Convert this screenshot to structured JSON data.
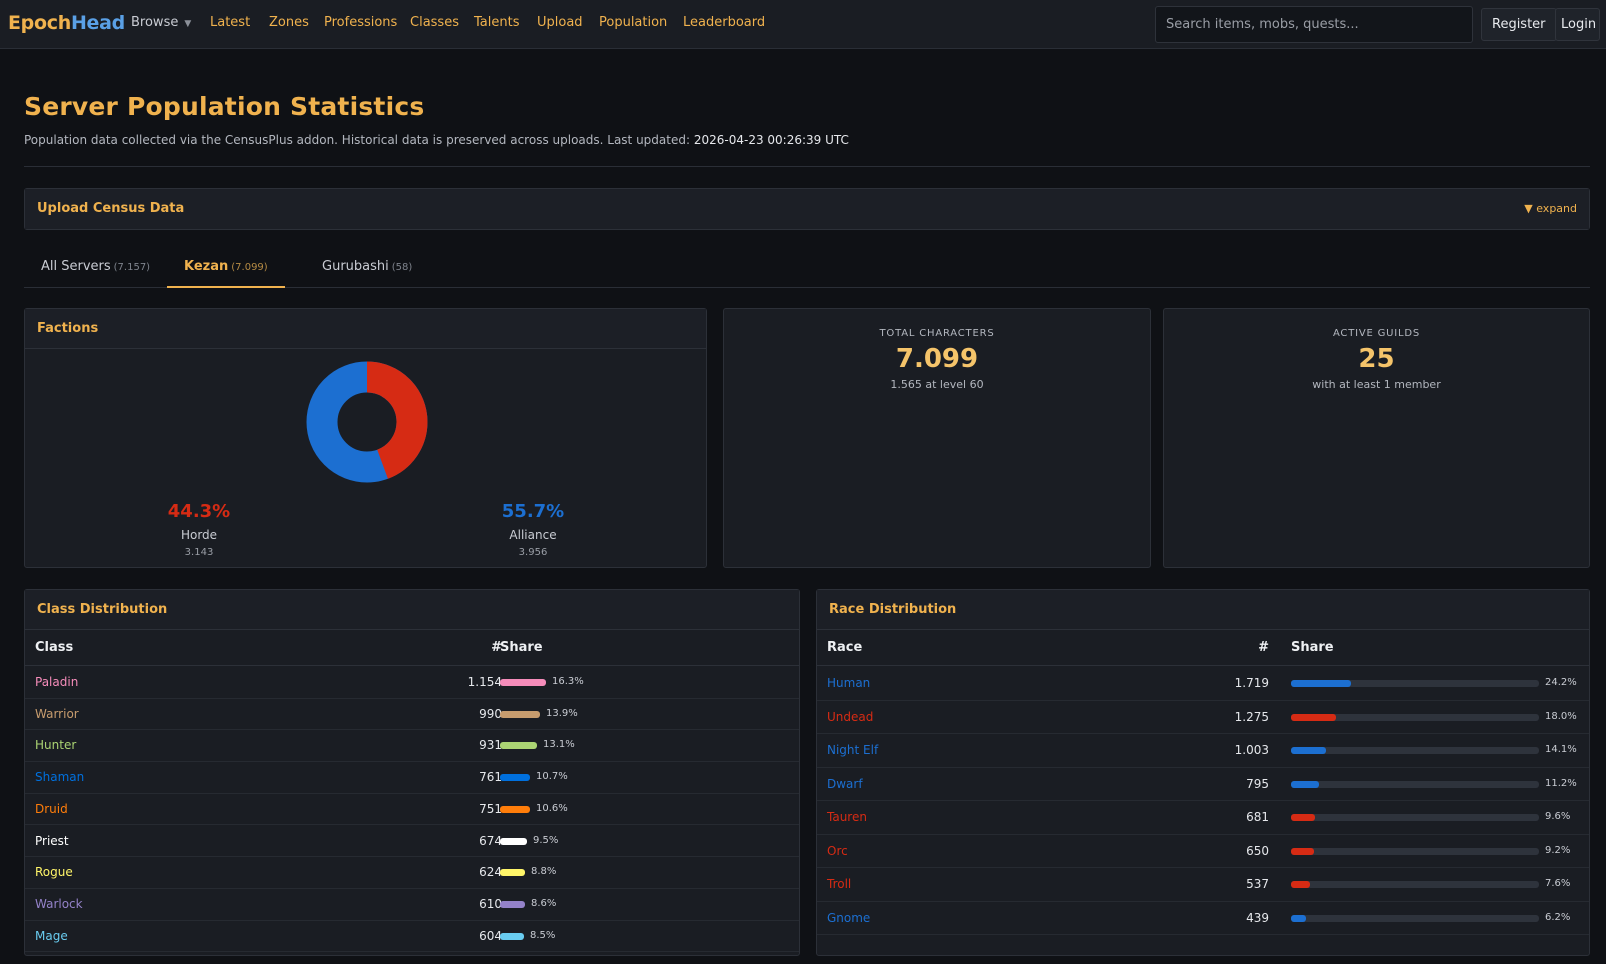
{
  "nav": {
    "logo_a": "Epoch",
    "logo_b": "Head",
    "browse": "Browse",
    "items": [
      "Latest",
      "Zones",
      "Professions",
      "Classes",
      "Talents",
      "Upload",
      "Population",
      "Leaderboard"
    ],
    "search_placeholder": "Search items, mobs, quests...",
    "register": "Register",
    "login": "Login"
  },
  "header": {
    "title": "Server Population Statistics",
    "subtitle": "Population data collected via the CensusPlus addon. Historical data is preserved across uploads. Last updated:",
    "updated": "2026-04-23 00:26:39 UTC"
  },
  "upload": {
    "title": "Upload Census Data",
    "expand": "▼ expand"
  },
  "tabs": [
    {
      "label": "All Servers",
      "count": "(7.157)"
    },
    {
      "label": "Kezan",
      "count": "(7.099)",
      "active": true
    },
    {
      "label": "Gurubashi",
      "count": "(58)"
    }
  ],
  "factions": {
    "title": "Factions",
    "horde": {
      "pct": "44.3%",
      "name": "Horde",
      "count": "3.143",
      "share": 0.443,
      "color": "#d62b14"
    },
    "alliance": {
      "pct": "55.7%",
      "name": "Alliance",
      "count": "3.956",
      "share": 0.557,
      "color": "#1c6fd1"
    }
  },
  "total_chars": {
    "label": "Total Characters",
    "value": "7.099",
    "sub": "1.565 at level 60"
  },
  "guilds": {
    "label": "Active Guilds",
    "value": "25",
    "sub": "with at least 1 member"
  },
  "class_dist": {
    "title": "Class Distribution",
    "headers": {
      "name": "Class",
      "num": "#",
      "share": "Share"
    },
    "rows": [
      {
        "name": "Paladin",
        "count": "1.154",
        "pct": "16.3%",
        "share": 0.163,
        "color": "#f58cba"
      },
      {
        "name": "Warrior",
        "count": "990",
        "pct": "13.9%",
        "share": 0.139,
        "color": "#c79c6e"
      },
      {
        "name": "Hunter",
        "count": "931",
        "pct": "13.1%",
        "share": 0.131,
        "color": "#abd473"
      },
      {
        "name": "Shaman",
        "count": "761",
        "pct": "10.7%",
        "share": 0.107,
        "color": "#0070de"
      },
      {
        "name": "Druid",
        "count": "751",
        "pct": "10.6%",
        "share": 0.106,
        "color": "#ff7d0a"
      },
      {
        "name": "Priest",
        "count": "674",
        "pct": "9.5%",
        "share": 0.095,
        "color": "#ffffff"
      },
      {
        "name": "Rogue",
        "count": "624",
        "pct": "8.8%",
        "share": 0.088,
        "color": "#fff569"
      },
      {
        "name": "Warlock",
        "count": "610",
        "pct": "8.6%",
        "share": 0.086,
        "color": "#9482c9"
      },
      {
        "name": "Mage",
        "count": "604",
        "pct": "8.5%",
        "share": 0.085,
        "color": "#69ccf0"
      }
    ]
  },
  "race_dist": {
    "title": "Race Distribution",
    "headers": {
      "name": "Race",
      "num": "#",
      "share": "Share"
    },
    "rows": [
      {
        "name": "Human",
        "count": "1.719",
        "pct": "24.2%",
        "share": 0.242,
        "color": "#1c6fd1"
      },
      {
        "name": "Undead",
        "count": "1.275",
        "pct": "18.0%",
        "share": 0.18,
        "color": "#d62b14"
      },
      {
        "name": "Night Elf",
        "count": "1.003",
        "pct": "14.1%",
        "share": 0.141,
        "color": "#1c6fd1"
      },
      {
        "name": "Dwarf",
        "count": "795",
        "pct": "11.2%",
        "share": 0.112,
        "color": "#1c6fd1"
      },
      {
        "name": "Tauren",
        "count": "681",
        "pct": "9.6%",
        "share": 0.096,
        "color": "#d62b14"
      },
      {
        "name": "Orc",
        "count": "650",
        "pct": "9.2%",
        "share": 0.092,
        "color": "#d62b14"
      },
      {
        "name": "Troll",
        "count": "537",
        "pct": "7.6%",
        "share": 0.076,
        "color": "#d62b14"
      },
      {
        "name": "Gnome",
        "count": "439",
        "pct": "6.2%",
        "share": 0.062,
        "color": "#1c6fd1"
      }
    ]
  }
}
